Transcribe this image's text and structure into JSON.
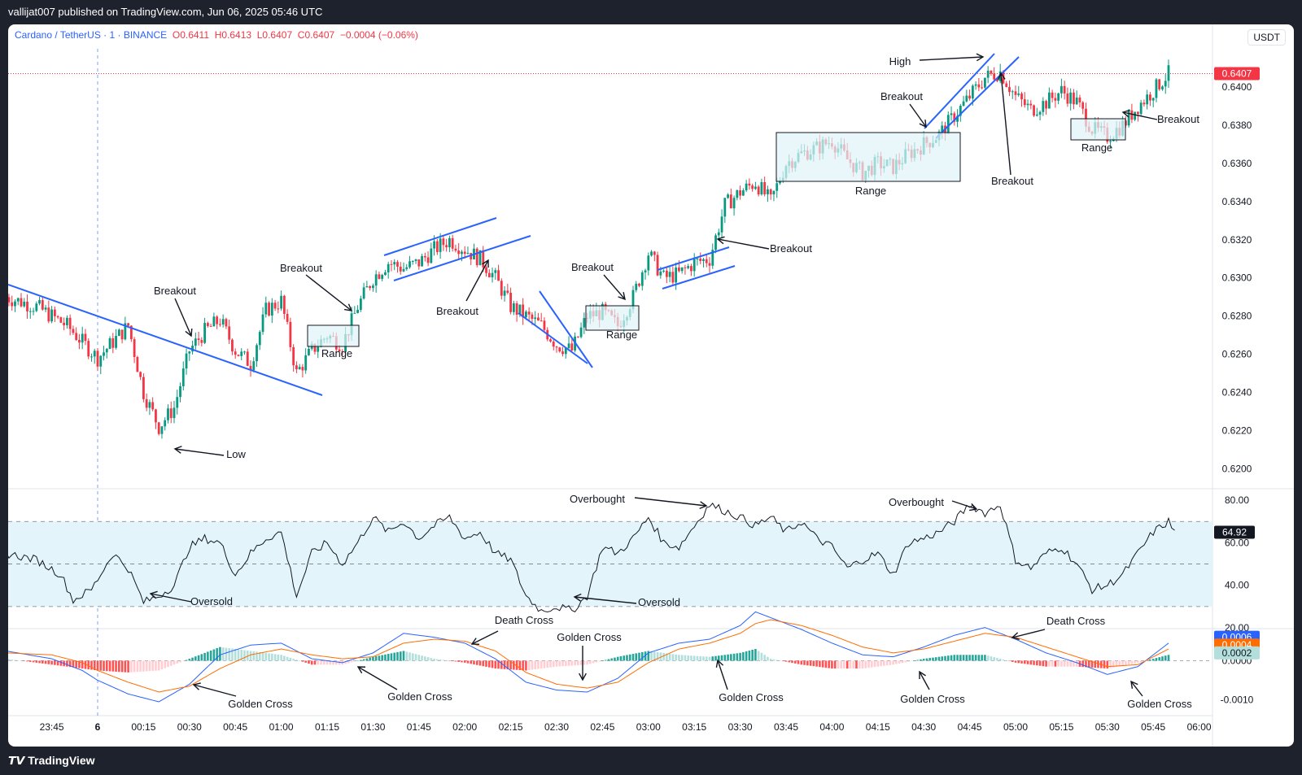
{
  "publisher_line": "vallijat007 published on TradingView.com, Jun 06, 2025 05:46 UTC",
  "footer_logo": "TradingView",
  "legend": {
    "symbol": "Cardano / TetherUS · 1 · BINANCE",
    "o": "O0.6411",
    "h": "H0.6413",
    "l": "L0.6407",
    "c": "C0.6407",
    "change": "−0.0004 (−0.06%)"
  },
  "currency": "USDT",
  "colors": {
    "up": "#089981",
    "down": "#f23645",
    "trend": "#2962ff",
    "range_fill": "#dff4f9",
    "rsi_band": "#e3f5fa",
    "macd_line": "#2962ff",
    "signal_line": "#ff6d00"
  },
  "chart_data": [
    {
      "type": "candlestick",
      "title": "Cardano / TetherUS · 1 · BINANCE",
      "ylim": [
        0.619,
        0.642
      ],
      "yticks": [
        "0.6400",
        "0.6380",
        "0.6360",
        "0.6340",
        "0.6320",
        "0.6300",
        "0.6280",
        "0.6260",
        "0.6240",
        "0.6220",
        "0.6200"
      ],
      "last_price": "0.6407",
      "x_labels": [
        "23:45",
        "6",
        "00:15",
        "00:30",
        "00:45",
        "01:00",
        "01:15",
        "01:30",
        "01:45",
        "02:00",
        "02:15",
        "02:30",
        "02:45",
        "03:00",
        "03:15",
        "03:30",
        "03:45",
        "04:00",
        "04:15",
        "04:30",
        "04:45",
        "05:00",
        "05:15",
        "05:30",
        "05:45",
        "06:00"
      ],
      "x_minutes": [
        -15,
        0,
        15,
        30,
        45,
        60,
        75,
        90,
        105,
        120,
        135,
        150,
        165,
        180,
        195,
        210,
        225,
        240,
        255,
        270,
        285,
        300,
        315,
        330,
        345,
        360
      ],
      "path": [
        [
          -30,
          0.629
        ],
        [
          -20,
          0.6285
        ],
        [
          -10,
          0.6275
        ],
        [
          0,
          0.6258
        ],
        [
          10,
          0.6275
        ],
        [
          15,
          0.624
        ],
        [
          20,
          0.6222
        ],
        [
          25,
          0.6232
        ],
        [
          30,
          0.6262
        ],
        [
          35,
          0.6272
        ],
        [
          40,
          0.6278
        ],
        [
          45,
          0.6262
        ],
        [
          50,
          0.6255
        ],
        [
          55,
          0.6283
        ],
        [
          60,
          0.6288
        ],
        [
          65,
          0.625
        ],
        [
          70,
          0.6262
        ],
        [
          75,
          0.627
        ],
        [
          80,
          0.6265
        ],
        [
          85,
          0.6285
        ],
        [
          90,
          0.63
        ],
        [
          95,
          0.6308
        ],
        [
          100,
          0.6305
        ],
        [
          105,
          0.6308
        ],
        [
          110,
          0.6315
        ],
        [
          115,
          0.632
        ],
        [
          120,
          0.6315
        ],
        [
          125,
          0.631
        ],
        [
          130,
          0.63
        ],
        [
          135,
          0.6285
        ],
        [
          140,
          0.628
        ],
        [
          145,
          0.6275
        ],
        [
          150,
          0.6265
        ],
        [
          155,
          0.6262
        ],
        [
          160,
          0.628
        ],
        [
          165,
          0.6282
        ],
        [
          170,
          0.6275
        ],
        [
          175,
          0.629
        ],
        [
          180,
          0.6313
        ],
        [
          185,
          0.63
        ],
        [
          190,
          0.6302
        ],
        [
          195,
          0.6308
        ],
        [
          200,
          0.631
        ],
        [
          205,
          0.6338
        ],
        [
          210,
          0.6345
        ],
        [
          215,
          0.635
        ],
        [
          220,
          0.634
        ],
        [
          225,
          0.636
        ],
        [
          230,
          0.6365
        ],
        [
          235,
          0.6368
        ],
        [
          240,
          0.6372
        ],
        [
          245,
          0.6362
        ],
        [
          250,
          0.6355
        ],
        [
          255,
          0.636
        ],
        [
          260,
          0.6358
        ],
        [
          265,
          0.6365
        ],
        [
          270,
          0.637
        ],
        [
          275,
          0.6375
        ],
        [
          280,
          0.6385
        ],
        [
          285,
          0.6395
        ],
        [
          290,
          0.6405
        ],
        [
          295,
          0.6408
        ],
        [
          300,
          0.6395
        ],
        [
          305,
          0.6388
        ],
        [
          310,
          0.6392
        ],
        [
          315,
          0.6398
        ],
        [
          320,
          0.6392
        ],
        [
          325,
          0.6378
        ],
        [
          330,
          0.6374
        ],
        [
          335,
          0.638
        ],
        [
          340,
          0.639
        ],
        [
          345,
          0.6398
        ],
        [
          350,
          0.6407
        ]
      ]
    },
    {
      "type": "line",
      "title": "RSI",
      "ylim": [
        20,
        85
      ],
      "yticks": [
        "80.00",
        "60.00",
        "40.00",
        "20.00"
      ],
      "band": [
        30,
        70
      ],
      "last_value": "64.92",
      "path": [
        [
          -30,
          55
        ],
        [
          -20,
          52
        ],
        [
          -12,
          45
        ],
        [
          -8,
          33
        ],
        [
          -2,
          38
        ],
        [
          5,
          55
        ],
        [
          10,
          48
        ],
        [
          15,
          32
        ],
        [
          20,
          35
        ],
        [
          25,
          40
        ],
        [
          30,
          58
        ],
        [
          35,
          62
        ],
        [
          40,
          60
        ],
        [
          45,
          45
        ],
        [
          50,
          55
        ],
        [
          55,
          62
        ],
        [
          60,
          65
        ],
        [
          65,
          35
        ],
        [
          70,
          55
        ],
        [
          75,
          60
        ],
        [
          80,
          50
        ],
        [
          85,
          60
        ],
        [
          90,
          72
        ],
        [
          95,
          65
        ],
        [
          100,
          70
        ],
        [
          105,
          62
        ],
        [
          110,
          68
        ],
        [
          115,
          72
        ],
        [
          120,
          62
        ],
        [
          125,
          65
        ],
        [
          130,
          55
        ],
        [
          135,
          52
        ],
        [
          140,
          35
        ],
        [
          145,
          28
        ],
        [
          150,
          30
        ],
        [
          155,
          28
        ],
        [
          160,
          35
        ],
        [
          165,
          58
        ],
        [
          170,
          55
        ],
        [
          175,
          62
        ],
        [
          180,
          72
        ],
        [
          185,
          60
        ],
        [
          190,
          58
        ],
        [
          195,
          68
        ],
        [
          200,
          78
        ],
        [
          205,
          75
        ],
        [
          210,
          72
        ],
        [
          215,
          68
        ],
        [
          220,
          72
        ],
        [
          225,
          65
        ],
        [
          230,
          70
        ],
        [
          235,
          62
        ],
        [
          240,
          58
        ],
        [
          245,
          48
        ],
        [
          250,
          52
        ],
        [
          255,
          55
        ],
        [
          260,
          45
        ],
        [
          265,
          60
        ],
        [
          270,
          62
        ],
        [
          275,
          65
        ],
        [
          280,
          70
        ],
        [
          285,
          78
        ],
        [
          290,
          74
        ],
        [
          295,
          78
        ],
        [
          300,
          52
        ],
        [
          305,
          48
        ],
        [
          310,
          55
        ],
        [
          315,
          58
        ],
        [
          320,
          50
        ],
        [
          325,
          38
        ],
        [
          330,
          40
        ],
        [
          335,
          45
        ],
        [
          340,
          55
        ],
        [
          345,
          65
        ],
        [
          350,
          70
        ],
        [
          352,
          64.92
        ]
      ]
    },
    {
      "type": "line",
      "title": "MACD",
      "ylim": [
        -0.0013,
        0.0008
      ],
      "yticks": [
        "0.0000",
        "-0.0010"
      ],
      "last_values": [
        "0.0006",
        "0.0004",
        "0.0002"
      ],
      "series": [
        {
          "values": [
            [
              -30,
              0.00025
            ],
            [
              -15,
              5e-05
            ],
            [
              -5,
              -0.00025
            ],
            [
              0,
              -0.0005
            ],
            [
              10,
              -0.00085
            ],
            [
              20,
              -0.00105
            ],
            [
              30,
              -0.0006
            ],
            [
              40,
              0.00015
            ],
            [
              50,
              0.0004
            ],
            [
              60,
              0.00045
            ],
            [
              70,
              5e-05
            ],
            [
              80,
              -5e-05
            ],
            [
              90,
              0.0002
            ],
            [
              100,
              0.0007
            ],
            [
              110,
              0.0006
            ],
            [
              120,
              0.00045
            ],
            [
              130,
              5e-05
            ],
            [
              140,
              -0.00055
            ],
            [
              150,
              -0.00075
            ],
            [
              160,
              -0.0008
            ],
            [
              170,
              -0.00045
            ],
            [
              180,
              0.0002
            ],
            [
              190,
              0.00045
            ],
            [
              200,
              0.00055
            ],
            [
              210,
              0.0009
            ],
            [
              215,
              0.00125
            ],
            [
              220,
              0.0011
            ],
            [
              230,
              0.0008
            ],
            [
              240,
              0.00045
            ],
            [
              250,
              0.00015
            ],
            [
              260,
              0.0001
            ],
            [
              270,
              0.00035
            ],
            [
              280,
              0.00065
            ],
            [
              290,
              0.00085
            ],
            [
              300,
              0.00055
            ],
            [
              310,
              0.0002
            ],
            [
              320,
              -5e-05
            ],
            [
              330,
              -0.00035
            ],
            [
              340,
              -0.00015
            ],
            [
              350,
              0.00045
            ]
          ]
        },
        {
          "values": [
            [
              -30,
              0.0002
            ],
            [
              -15,
              0.00015
            ],
            [
              -5,
              -5e-05
            ],
            [
              0,
              -0.00025
            ],
            [
              10,
              -0.00055
            ],
            [
              20,
              -0.0008
            ],
            [
              30,
              -0.00065
            ],
            [
              40,
              -0.0002
            ],
            [
              50,
              0.00015
            ],
            [
              60,
              0.0003
            ],
            [
              70,
              0.00015
            ],
            [
              80,
              5e-05
            ],
            [
              90,
              0.0001
            ],
            [
              100,
              0.00045
            ],
            [
              110,
              0.00055
            ],
            [
              120,
              0.0005
            ],
            [
              130,
              0.00025
            ],
            [
              140,
              -0.0003
            ],
            [
              150,
              -0.0006
            ],
            [
              160,
              -0.0007
            ],
            [
              170,
              -0.00055
            ],
            [
              180,
              -5e-05
            ],
            [
              190,
              0.0003
            ],
            [
              200,
              0.00045
            ],
            [
              210,
              0.0007
            ],
            [
              215,
              0.00095
            ],
            [
              220,
              0.00105
            ],
            [
              230,
              0.0009
            ],
            [
              240,
              0.00065
            ],
            [
              250,
              0.00035
            ],
            [
              260,
              0.0002
            ],
            [
              270,
              0.0003
            ],
            [
              280,
              0.0005
            ],
            [
              290,
              0.0007
            ],
            [
              300,
              0.0006
            ],
            [
              310,
              0.00035
            ],
            [
              320,
              0.0001
            ],
            [
              330,
              -0.00015
            ],
            [
              340,
              -0.0001
            ],
            [
              350,
              0.0003
            ]
          ]
        }
      ]
    }
  ],
  "annotations": {
    "breakout_1": "Breakout",
    "breakout_2": "Breakout",
    "breakout_3": "Breakout",
    "breakout_4": "Breakout",
    "breakout_5": "Breakout",
    "breakout_6": "Breakout",
    "breakout_7": "Breakout",
    "breakout_8": "Breakout",
    "range_1": "Range",
    "range_2": "Range",
    "range_3": "Range",
    "range_4": "Range",
    "low": "Low",
    "high": "High",
    "overbought_1": "Overbought",
    "overbought_2": "Overbought",
    "oversold_1": "Oversold",
    "oversold_2": "Oversold",
    "death_cross_1": "Death Cross",
    "death_cross_2": "Death Cross",
    "golden_cross_1": "Golden Cross",
    "golden_cross_2": "Golden Cross",
    "golden_cross_3": "Golden Cross",
    "golden_cross_4": "Golden Cross",
    "golden_cross_5": "Golden Cross",
    "golden_cross_6": "Golden Cross"
  }
}
